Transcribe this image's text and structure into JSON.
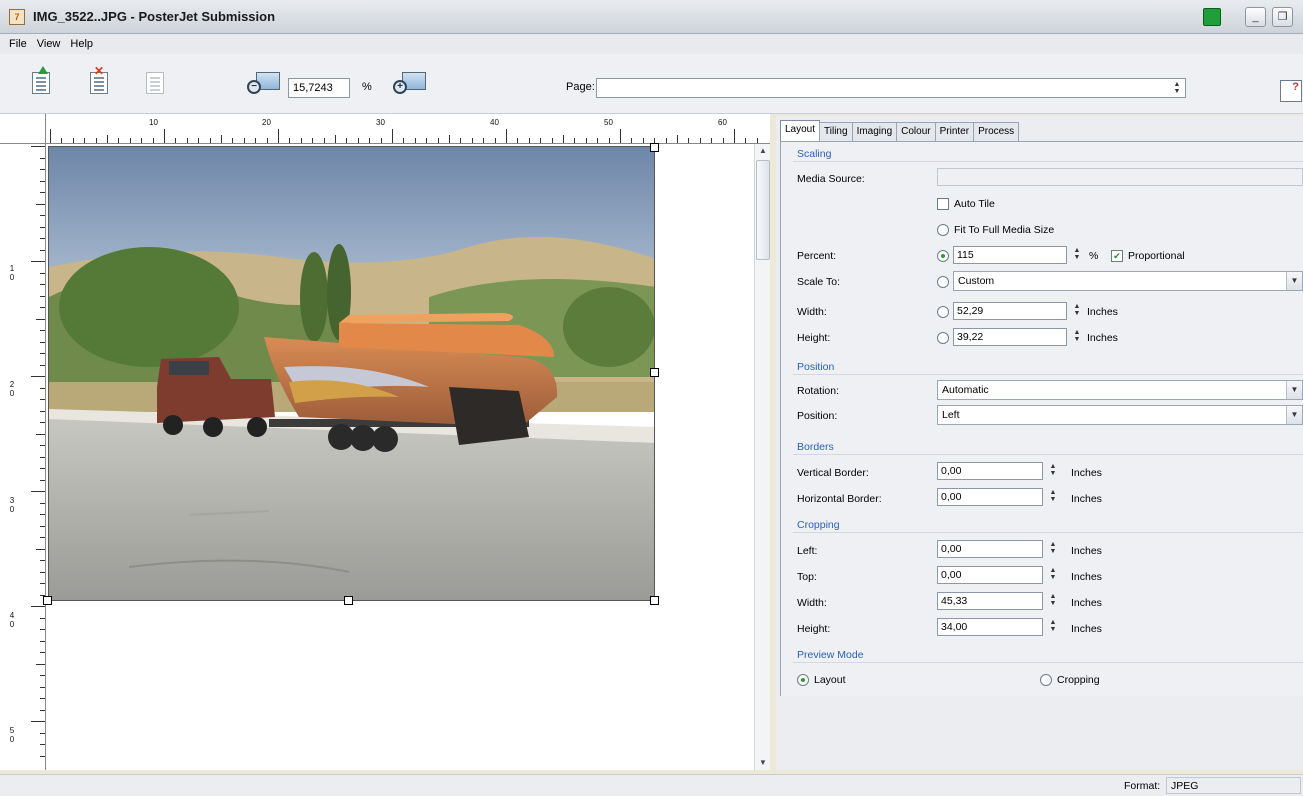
{
  "window": {
    "title": "IMG_3522..JPG - PosterJet Submission",
    "app_icon": "7",
    "minimize": "_",
    "restore": "❐"
  },
  "menu": [
    {
      "label": "File",
      "mnemonic": "F"
    },
    {
      "label": "View",
      "mnemonic": "V"
    },
    {
      "label": "Help",
      "mnemonic": "H"
    }
  ],
  "toolbar": {
    "zoom_value": "15,7243",
    "zoom_unit": "%",
    "page_label": "Page:",
    "page_value": ""
  },
  "ruler": {
    "top_labels": [
      "10",
      "20",
      "30",
      "40",
      "50",
      "60"
    ],
    "left_labels": [
      "1 0",
      "2 0",
      "3 0",
      "4 0",
      "5 0"
    ]
  },
  "tabs": [
    "Layout",
    "Tiling",
    "Imaging",
    "Colour",
    "Printer",
    "Process"
  ],
  "layout": {
    "scaling": {
      "title": "Scaling",
      "media_source_label": "Media Source:",
      "media_source_value": "",
      "auto_tile": "Auto Tile",
      "auto_tile_checked": false,
      "fit_full": "Fit To Full Media Size",
      "percent_label": "Percent:",
      "percent_value": "115",
      "percent_unit": "%",
      "proportional": "Proportional",
      "proportional_checked": true,
      "scale_to_label": "Scale To:",
      "scale_to_value": "Custom",
      "width_label": "Width:",
      "width_value": "52,29",
      "width_unit": "Inches",
      "height_label": "Height:",
      "height_value": "39,22",
      "height_unit": "Inches"
    },
    "position": {
      "title": "Position",
      "rotation_label": "Rotation:",
      "rotation_value": "Automatic",
      "position_label": "Position:",
      "position_value": "Left"
    },
    "borders": {
      "title": "Borders",
      "vertical_label": "Vertical Border:",
      "vertical_value": "0,00",
      "horizontal_label": "Horizontal Border:",
      "horizontal_value": "0,00",
      "unit": "Inches"
    },
    "cropping": {
      "title": "Cropping",
      "left_label": "Left:",
      "left_value": "0,00",
      "top_label": "Top:",
      "top_value": "0,00",
      "width_label": "Width:",
      "width_value": "45,33",
      "height_label": "Height:",
      "height_value": "34,00",
      "unit": "Inches"
    },
    "preview": {
      "title": "Preview Mode",
      "layout": "Layout",
      "cropping": "Cropping",
      "selected": "Layout"
    }
  },
  "status": {
    "format_label": "Format:",
    "format_value": "JPEG"
  },
  "colors": {
    "accent_link": "#2a5fbe",
    "status_light": "#1f9e3a",
    "radio_on": "#2aa02a"
  }
}
